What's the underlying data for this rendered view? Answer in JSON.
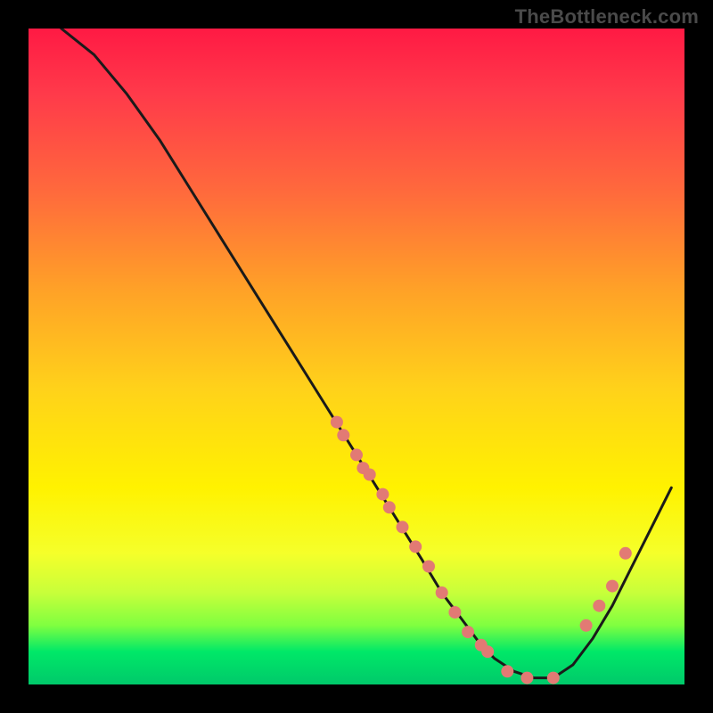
{
  "attribution": "TheBottleneck.com",
  "colors": {
    "background_black": "#000000",
    "gradient_top": "#ff1a44",
    "gradient_mid": "#ffd21a",
    "gradient_bottom": "#00c96a",
    "curve_stroke": "#1a1a1a",
    "marker_fill": "#e27a74"
  },
  "chart_data": {
    "type": "line",
    "title": "",
    "xlabel": "",
    "ylabel": "",
    "xlim": [
      0,
      100
    ],
    "ylim": [
      0,
      100
    ],
    "grid": false,
    "legend": false,
    "note": "Axes are unlabeled in the image; values are estimated from pixel positions on a 0–100 scale.",
    "series": [
      {
        "name": "bottleneck-curve",
        "x": [
          5,
          10,
          15,
          20,
          25,
          30,
          35,
          40,
          45,
          50,
          55,
          60,
          63,
          66,
          69,
          71,
          74,
          77,
          80,
          83,
          86,
          89,
          92,
          95,
          98
        ],
        "y": [
          100,
          96,
          90,
          83,
          75,
          67,
          59,
          51,
          43,
          35,
          27,
          19,
          14,
          10,
          6,
          4,
          2,
          1,
          1,
          3,
          7,
          12,
          18,
          24,
          30
        ]
      }
    ],
    "markers": {
      "name": "highlight-points",
      "x": [
        47,
        48,
        50,
        51,
        52,
        54,
        55,
        57,
        59,
        61,
        63,
        65,
        67,
        69,
        70,
        73,
        76,
        80,
        85,
        87,
        89,
        91
      ],
      "y": [
        40,
        38,
        35,
        33,
        32,
        29,
        27,
        24,
        21,
        18,
        14,
        11,
        8,
        6,
        5,
        2,
        1,
        1,
        9,
        12,
        15,
        20
      ]
    }
  }
}
